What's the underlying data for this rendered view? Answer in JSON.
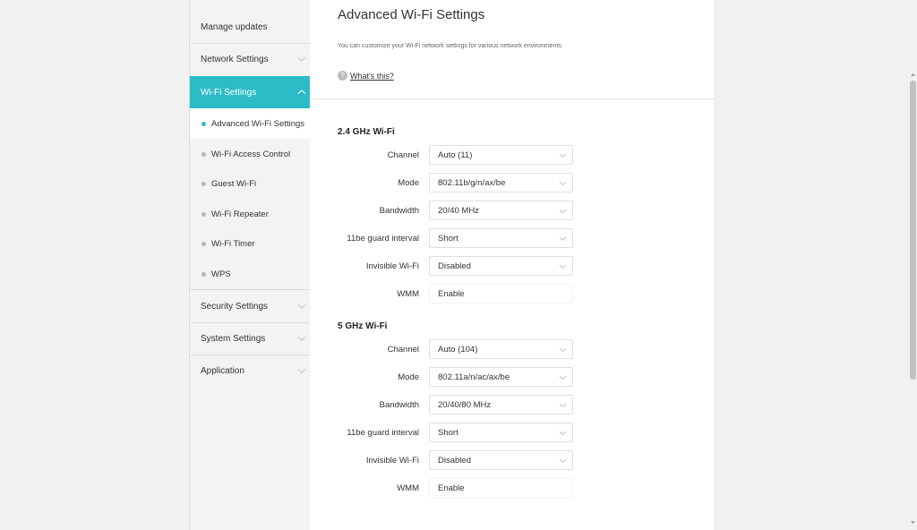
{
  "sidebar": {
    "manage_updates": "Manage updates",
    "network_settings": "Network Settings",
    "wifi_settings": "Wi-Fi Settings",
    "submenu": {
      "advanced": "Advanced Wi-Fi Settings",
      "access_control": "Wi-Fi Access Control",
      "guest": "Guest Wi-Fi",
      "repeater": "Wi-Fi Repeater",
      "timer": "Wi-Fi Timer",
      "wps": "WPS"
    },
    "security_settings": "Security Settings",
    "system_settings": "System Settings",
    "application": "Application"
  },
  "main": {
    "title": "Advanced Wi-Fi Settings",
    "description": "You can customize your Wi-Fi network settings for various network environments.",
    "help_icon_text": "?",
    "help_link": "What's this?",
    "band24": {
      "title": "2.4 GHz Wi-Fi",
      "channel_label": "Channel",
      "channel_value": "Auto (11)",
      "mode_label": "Mode",
      "mode_value": "802.11b/g/n/ax/be",
      "bandwidth_label": "Bandwidth",
      "bandwidth_value": "20/40 MHz",
      "guard_label": "11be guard interval",
      "guard_value": "Short",
      "invisible_label": "Invisible Wi-Fi",
      "invisible_value": "Disabled",
      "wmm_label": "WMM",
      "wmm_value": "Enable"
    },
    "band5": {
      "title": "5 GHz Wi-Fi",
      "channel_label": "Channel",
      "channel_value": "Auto (104)",
      "mode_label": "Mode",
      "mode_value": "802.11a/n/ac/ax/be",
      "bandwidth_label": "Bandwidth",
      "bandwidth_value": "20/40/80 MHz",
      "guard_label": "11be guard interval",
      "guard_value": "Short",
      "invisible_label": "Invisible Wi-Fi",
      "invisible_value": "Disabled",
      "wmm_label": "WMM",
      "wmm_value": "Enable"
    }
  },
  "colors": {
    "accent": "#2cbcc7",
    "sidebar_bg": "#f3f3f3",
    "page_bg": "#f1f1f1"
  },
  "icons": {
    "expand": "chevron-down-icon",
    "collapse": "chevron-up-icon",
    "help": "question-circle-icon",
    "bullet": "dot-icon"
  }
}
